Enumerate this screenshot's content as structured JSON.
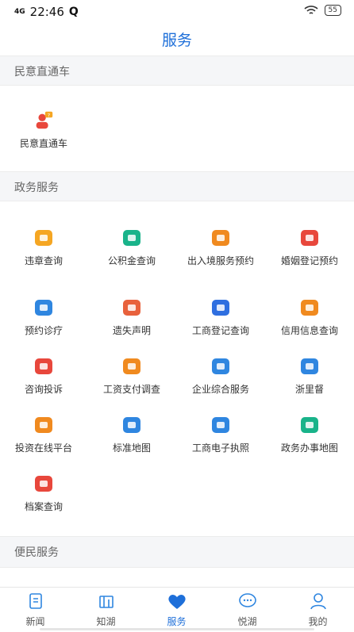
{
  "status": {
    "time": "22:46",
    "signal": "4G",
    "battery": "55"
  },
  "header": {
    "title": "服务"
  },
  "sections": {
    "s1": "民意直通车",
    "s2": "政务服务",
    "s3": "便民服务"
  },
  "minyi": {
    "label": "民意直通车"
  },
  "services": [
    {
      "label": "违章查询",
      "icon": "traffic-light-icon",
      "color": "#f5a623"
    },
    {
      "label": "公积金查询",
      "icon": "housing-fund-icon",
      "color": "#19b38a"
    },
    {
      "label": "出入境服务预约",
      "icon": "airplane-globe-icon",
      "color": "#f08a1f"
    },
    {
      "label": "婚姻登记预约",
      "icon": "marriage-cert-icon",
      "color": "#e8473c"
    },
    {
      "label": "预约诊疗",
      "icon": "calendar-medical-icon",
      "color": "#2f86e0"
    },
    {
      "label": "遗失声明",
      "icon": "document-edit-icon",
      "color": "#e8613c"
    },
    {
      "label": "工商登记查询",
      "icon": "id-search-icon",
      "color": "#2f6fe0"
    },
    {
      "label": "信用信息查询",
      "icon": "credit-card-search-icon",
      "color": "#f08a1f"
    },
    {
      "label": "咨询投诉",
      "icon": "alert-icon",
      "color": "#e8473c"
    },
    {
      "label": "工资支付调查",
      "icon": "salary-search-icon",
      "color": "#f08a1f"
    },
    {
      "label": "企业综合服务",
      "icon": "hand-icon",
      "color": "#2f86e0"
    },
    {
      "label": "浙里督",
      "icon": "eye-shield-icon",
      "color": "#2f86e0"
    },
    {
      "label": "投资在线平台",
      "icon": "yuan-coin-icon",
      "color": "#f08a1f"
    },
    {
      "label": "标准地图",
      "icon": "map-grid-icon",
      "color": "#2f86e0"
    },
    {
      "label": "工商电子执照",
      "icon": "license-icon",
      "color": "#2f86e0"
    },
    {
      "label": "政务办事地图",
      "icon": "map-pin-icon",
      "color": "#19b38a"
    },
    {
      "label": "档案查询",
      "icon": "archive-search-icon",
      "color": "#e8473c"
    }
  ],
  "tabs": [
    {
      "label": "新闻",
      "icon": "news-icon"
    },
    {
      "label": "知湖",
      "icon": "book-icon"
    },
    {
      "label": "服务",
      "icon": "heart-icon"
    },
    {
      "label": "悦湖",
      "icon": "chat-icon"
    },
    {
      "label": "我的",
      "icon": "user-icon"
    }
  ]
}
